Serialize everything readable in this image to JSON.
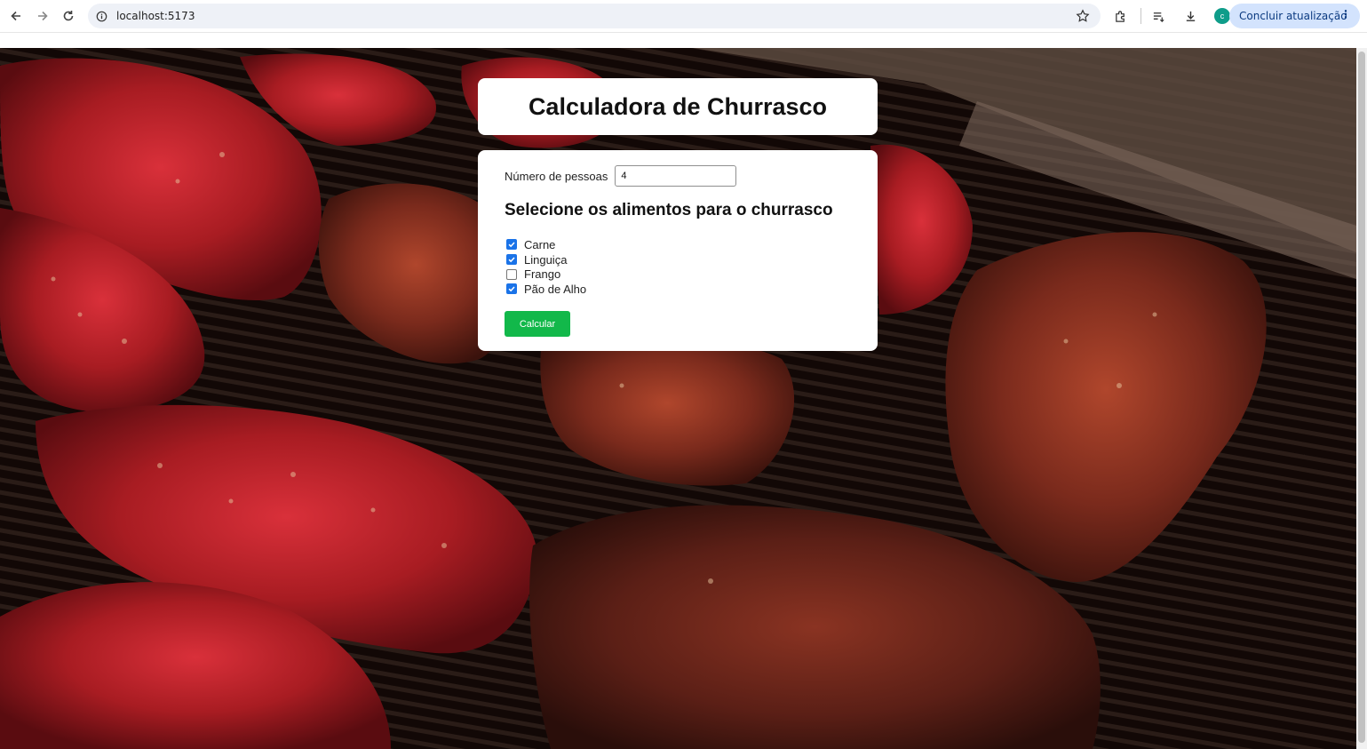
{
  "browser": {
    "url": "localhost:5173",
    "update_label": "Concluir atualização",
    "profile_initial": "c",
    "icons": [
      "back-icon",
      "forward-icon",
      "reload-icon",
      "site-info-icon",
      "star-icon",
      "extensions-icon",
      "reading-list-icon",
      "download-icon",
      "profile-avatar",
      "menu-icon"
    ]
  },
  "app": {
    "title": "Calculadora de Churrasco",
    "people_label": "Número de pessoas",
    "people_value": "4",
    "section_title": "Selecione os alimentos para o churrasco",
    "foods": [
      {
        "label": "Carne",
        "checked": true
      },
      {
        "label": "Linguiça",
        "checked": true
      },
      {
        "label": "Frango",
        "checked": false
      },
      {
        "label": "Pão de Alho",
        "checked": true
      }
    ],
    "calculate_label": "Calcular",
    "colors": {
      "button": "#12b84a",
      "checkbox": "#1a73e8",
      "card": "#ffffff"
    }
  }
}
